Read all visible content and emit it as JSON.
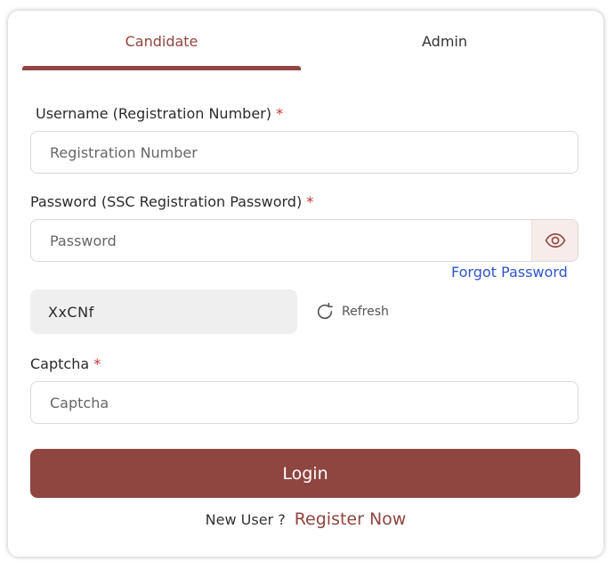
{
  "tabs": {
    "candidate": "Candidate",
    "admin": "Admin",
    "active": "Candidate"
  },
  "form": {
    "username_label": "Username (Registration Number)",
    "username_placeholder": "Registration Number",
    "password_label": "Password (SSC Registration Password)",
    "password_placeholder": "Password",
    "required_mark": "*",
    "forgot_password": "Forgot Password",
    "captcha_code": "XxCNf",
    "refresh_label": "Refresh",
    "captcha_label": "Captcha",
    "captcha_placeholder": "Captcha",
    "login_button": "Login"
  },
  "footer": {
    "new_user": "New User ?",
    "register_now": "Register Now"
  },
  "icons": {
    "password_toggle": "eye-icon",
    "refresh": "refresh-icon"
  },
  "colors": {
    "brand": "#8f4540",
    "link": "#2f55c8",
    "required": "#d12c2c"
  }
}
